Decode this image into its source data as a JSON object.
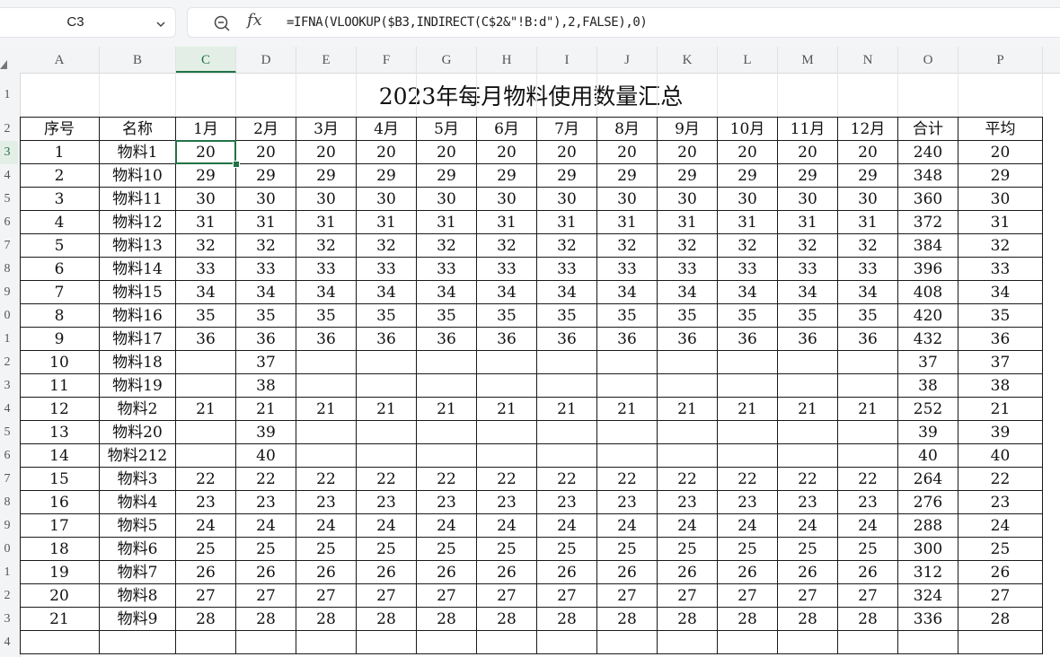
{
  "formula_bar": {
    "name_box": "C3",
    "formula": "=IFNA(VLOOKUP($B3,INDIRECT(C$2&\"!B:d\"),2,FALSE),0)",
    "zoom_icon": "zoom-icon",
    "fx_icon": "fx-icon",
    "dropdown_icon": "chevron-down-icon",
    "fx_label": "fx"
  },
  "grid": {
    "columns": [
      "A",
      "B",
      "C",
      "D",
      "E",
      "F",
      "G",
      "H",
      "I",
      "J",
      "K",
      "L",
      "M",
      "N",
      "O",
      "P"
    ],
    "selected_column": "C",
    "row_labels": [
      "1",
      "2",
      "3",
      "4",
      "5",
      "6",
      "7",
      "8",
      "9",
      "0",
      "1",
      "2",
      "3",
      "4",
      "5",
      "6",
      "7",
      "8",
      "9",
      "0",
      "1",
      "2",
      "3",
      "4"
    ],
    "selected_row_index": 2,
    "accent_color": "#217346",
    "selected_cell": "C3"
  },
  "sheet": {
    "title": "2023年每月物料使用数量汇总",
    "headers": [
      "序号",
      "名称",
      "1月",
      "2月",
      "3月",
      "4月",
      "5月",
      "6月",
      "7月",
      "8月",
      "9月",
      "10月",
      "11月",
      "12月",
      "合计",
      "平均"
    ],
    "rows": [
      [
        "1",
        "物料1",
        "20",
        "20",
        "20",
        "20",
        "20",
        "20",
        "20",
        "20",
        "20",
        "20",
        "20",
        "20",
        "240",
        "20"
      ],
      [
        "2",
        "物料10",
        "29",
        "29",
        "29",
        "29",
        "29",
        "29",
        "29",
        "29",
        "29",
        "29",
        "29",
        "29",
        "348",
        "29"
      ],
      [
        "3",
        "物料11",
        "30",
        "30",
        "30",
        "30",
        "30",
        "30",
        "30",
        "30",
        "30",
        "30",
        "30",
        "30",
        "360",
        "30"
      ],
      [
        "4",
        "物料12",
        "31",
        "31",
        "31",
        "31",
        "31",
        "31",
        "31",
        "31",
        "31",
        "31",
        "31",
        "31",
        "372",
        "31"
      ],
      [
        "5",
        "物料13",
        "32",
        "32",
        "32",
        "32",
        "32",
        "32",
        "32",
        "32",
        "32",
        "32",
        "32",
        "32",
        "384",
        "32"
      ],
      [
        "6",
        "物料14",
        "33",
        "33",
        "33",
        "33",
        "33",
        "33",
        "33",
        "33",
        "33",
        "33",
        "33",
        "33",
        "396",
        "33"
      ],
      [
        "7",
        "物料15",
        "34",
        "34",
        "34",
        "34",
        "34",
        "34",
        "34",
        "34",
        "34",
        "34",
        "34",
        "34",
        "408",
        "34"
      ],
      [
        "8",
        "物料16",
        "35",
        "35",
        "35",
        "35",
        "35",
        "35",
        "35",
        "35",
        "35",
        "35",
        "35",
        "35",
        "420",
        "35"
      ],
      [
        "9",
        "物料17",
        "36",
        "36",
        "36",
        "36",
        "36",
        "36",
        "36",
        "36",
        "36",
        "36",
        "36",
        "36",
        "432",
        "36"
      ],
      [
        "10",
        "物料18",
        "",
        "37",
        "",
        "",
        "",
        "",
        "",
        "",
        "",
        "",
        "",
        "",
        "37",
        "37"
      ],
      [
        "11",
        "物料19",
        "",
        "38",
        "",
        "",
        "",
        "",
        "",
        "",
        "",
        "",
        "",
        "",
        "38",
        "38"
      ],
      [
        "12",
        "物料2",
        "21",
        "21",
        "21",
        "21",
        "21",
        "21",
        "21",
        "21",
        "21",
        "21",
        "21",
        "21",
        "252",
        "21"
      ],
      [
        "13",
        "物料20",
        "",
        "39",
        "",
        "",
        "",
        "",
        "",
        "",
        "",
        "",
        "",
        "",
        "39",
        "39"
      ],
      [
        "14",
        "物料212",
        "",
        "40",
        "",
        "",
        "",
        "",
        "",
        "",
        "",
        "",
        "",
        "",
        "40",
        "40"
      ],
      [
        "15",
        "物料3",
        "22",
        "22",
        "22",
        "22",
        "22",
        "22",
        "22",
        "22",
        "22",
        "22",
        "22",
        "22",
        "264",
        "22"
      ],
      [
        "16",
        "物料4",
        "23",
        "23",
        "23",
        "23",
        "23",
        "23",
        "23",
        "23",
        "23",
        "23",
        "23",
        "23",
        "276",
        "23"
      ],
      [
        "17",
        "物料5",
        "24",
        "24",
        "24",
        "24",
        "24",
        "24",
        "24",
        "24",
        "24",
        "24",
        "24",
        "24",
        "288",
        "24"
      ],
      [
        "18",
        "物料6",
        "25",
        "25",
        "25",
        "25",
        "25",
        "25",
        "25",
        "25",
        "25",
        "25",
        "25",
        "25",
        "300",
        "25"
      ],
      [
        "19",
        "物料7",
        "26",
        "26",
        "26",
        "26",
        "26",
        "26",
        "26",
        "26",
        "26",
        "26",
        "26",
        "26",
        "312",
        "26"
      ],
      [
        "20",
        "物料8",
        "27",
        "27",
        "27",
        "27",
        "27",
        "27",
        "27",
        "27",
        "27",
        "27",
        "27",
        "27",
        "324",
        "27"
      ],
      [
        "21",
        "物料9",
        "28",
        "28",
        "28",
        "28",
        "28",
        "28",
        "28",
        "28",
        "28",
        "28",
        "28",
        "28",
        "336",
        "28"
      ]
    ]
  }
}
